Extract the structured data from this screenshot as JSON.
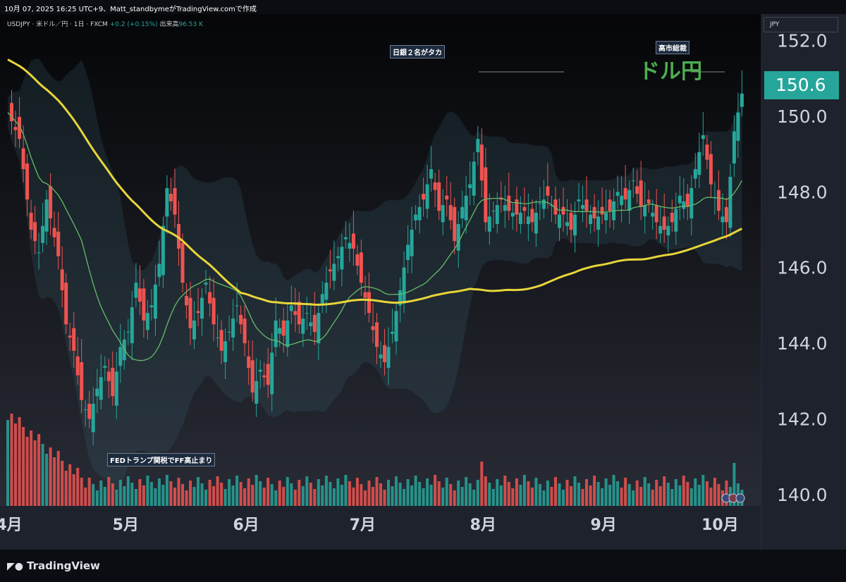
{
  "header": {
    "title": "10月 07, 2025 16:25 UTC+9、Matt_standbymeがTradingView.comで作成"
  },
  "legend": {
    "symbol": "USDJPY · 米ドル／円 · 1日 · FXCM",
    "change": "+0.2 (+0.15%)",
    "volume_label": "出来高",
    "volume_value": "96.53 K"
  },
  "currency": "JPY",
  "last_price": "150.6",
  "annotations": {
    "boj": "日銀２名がタカ",
    "takaichi": "高市総裁",
    "dollar_yen": "ドル円",
    "fed": "FEDトランプ関税でFF高止まり"
  },
  "footer": {
    "logo": "TradingView"
  },
  "colors": {
    "up": "#26a69a",
    "down": "#ef5350",
    "ma_long": "#e8d53a",
    "ma_short": "#66bb6a",
    "annotation_green": "#4caf50"
  },
  "chart_data": {
    "type": "candlestick",
    "y_ticks": [
      "140.0",
      "142.0",
      "144.0",
      "146.0",
      "148.0",
      "150.0",
      "152.0"
    ],
    "ylim": [
      139.7,
      152.7
    ],
    "x_ticks": [
      "4月",
      "5月",
      "6月",
      "7月",
      "8月",
      "9月",
      "10月"
    ],
    "x_tick_days": [
      0,
      30,
      61,
      91,
      122,
      153,
      183
    ],
    "x_range_days": [
      -2,
      194
    ],
    "closes": [
      [
        0,
        150.1
      ],
      [
        3,
        149.4
      ],
      [
        6,
        147.0
      ],
      [
        8,
        146.4
      ],
      [
        10,
        147.8
      ],
      [
        13,
        146.3
      ],
      [
        15,
        144.5
      ],
      [
        17,
        143.8
      ],
      [
        19,
        142.5
      ],
      [
        21,
        142.0
      ],
      [
        23,
        142.8
      ],
      [
        25,
        143.4
      ],
      [
        27,
        142.6
      ],
      [
        29,
        143.9
      ],
      [
        31,
        144.3
      ],
      [
        33,
        145.6
      ],
      [
        35,
        144.6
      ],
      [
        37,
        145.0
      ],
      [
        39,
        146.1
      ],
      [
        41,
        148.1
      ],
      [
        43,
        147.4
      ],
      [
        45,
        145.6
      ],
      [
        47,
        144.4
      ],
      [
        49,
        144.8
      ],
      [
        51,
        145.6
      ],
      [
        53,
        144.5
      ],
      [
        55,
        143.8
      ],
      [
        57,
        144.3
      ],
      [
        59,
        145.0
      ],
      [
        61,
        144.0
      ],
      [
        63,
        142.7
      ],
      [
        65,
        143.3
      ],
      [
        67,
        142.9
      ],
      [
        69,
        144.6
      ],
      [
        71,
        144.2
      ],
      [
        73,
        145.0
      ],
      [
        75,
        144.5
      ],
      [
        77,
        144.8
      ],
      [
        79,
        144.3
      ],
      [
        81,
        145.3
      ],
      [
        83,
        145.9
      ],
      [
        85,
        146.3
      ],
      [
        87,
        146.8
      ],
      [
        89,
        146.5
      ],
      [
        91,
        145.6
      ],
      [
        93,
        144.8
      ],
      [
        95,
        143.9
      ],
      [
        97,
        143.5
      ],
      [
        99,
        144.3
      ],
      [
        101,
        145.4
      ],
      [
        103,
        146.6
      ],
      [
        105,
        147.4
      ],
      [
        107,
        147.8
      ],
      [
        109,
        148.6
      ],
      [
        111,
        147.5
      ],
      [
        113,
        147.8
      ],
      [
        115,
        146.7
      ],
      [
        117,
        147.6
      ],
      [
        119,
        148.2
      ],
      [
        121,
        149.4
      ],
      [
        123,
        147.2
      ],
      [
        125,
        147.5
      ],
      [
        127,
        147.8
      ],
      [
        129,
        147.5
      ],
      [
        131,
        147.4
      ],
      [
        133,
        147.5
      ],
      [
        135,
        147.2
      ],
      [
        137,
        147.7
      ],
      [
        139,
        147.9
      ],
      [
        141,
        147.4
      ],
      [
        143,
        147.4
      ],
      [
        145,
        147.0
      ],
      [
        147,
        147.8
      ],
      [
        149,
        147.5
      ],
      [
        151,
        147.3
      ],
      [
        153,
        147.4
      ],
      [
        155,
        147.5
      ],
      [
        157,
        148.0
      ],
      [
        159,
        147.8
      ],
      [
        161,
        148.3
      ],
      [
        163,
        147.6
      ],
      [
        165,
        147.7
      ],
      [
        167,
        147.2
      ],
      [
        169,
        147.0
      ],
      [
        171,
        147.2
      ],
      [
        173,
        147.9
      ],
      [
        175,
        147.6
      ],
      [
        177,
        148.6
      ],
      [
        179,
        149.5
      ],
      [
        181,
        148.2
      ],
      [
        183,
        147.5
      ],
      [
        185,
        147.2
      ],
      [
        187,
        149.6
      ],
      [
        189,
        150.6
      ]
    ]
  }
}
